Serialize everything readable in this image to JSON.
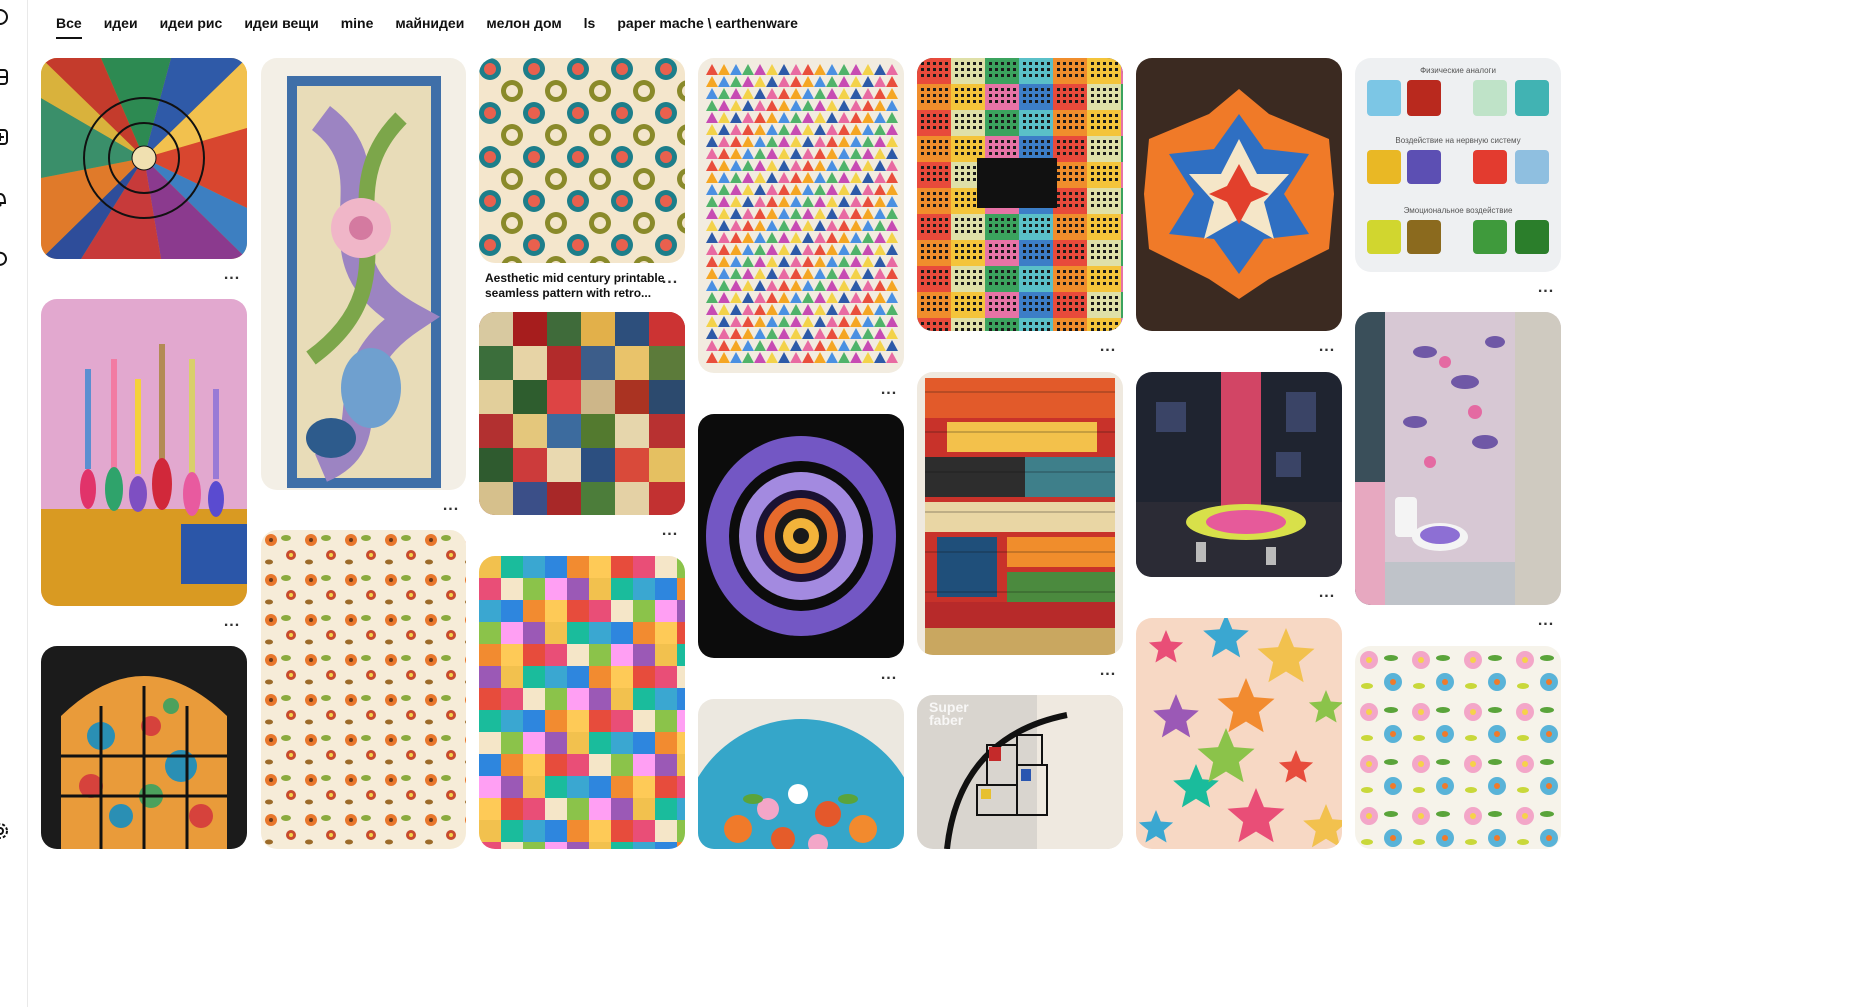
{
  "tabs": [
    {
      "label": "Все",
      "active": true
    },
    {
      "label": "идеи"
    },
    {
      "label": "идеи рис"
    },
    {
      "label": "идеи вещи"
    },
    {
      "label": "mine"
    },
    {
      "label": "майнидеи"
    },
    {
      "label": "мелон дом"
    },
    {
      "label": "ls"
    },
    {
      "label": "paper mache \\ earthenware"
    }
  ],
  "rail": {
    "icons": [
      "pinterest-icon",
      "home-icon",
      "create-icon",
      "bell-icon",
      "messages-icon",
      "settings-icon"
    ]
  },
  "pins": {
    "p1": "Multicolor geometric painting",
    "p2": "Pastel floral textile panel",
    "p3": "Polka dot pattern",
    "p3_caption": "Aesthetic mid century printable\nseamless pattern with retro...",
    "p4": "Patchwork quilt",
    "p5": "Color checkerboard",
    "p6": "Triangle weave pattern",
    "p7": "Purple swirl poster",
    "p8": "Flower circle print",
    "p9": "Pixel city painting",
    "p10": "Woven rug",
    "p11": "Modern staircase",
    "p12": "Geometric star mosaic",
    "p13": "Glitter room",
    "p14": "Star collage",
    "p15": "Color effects chart",
    "p16": "Flower mosaic bathroom",
    "p17": "Floral dot pattern",
    "p18": "Candlesticks on table",
    "p19": "Stained glass window art"
  },
  "chart_overlay_p15": {
    "title": "Физические аналоги",
    "sub1": "Воздействие на нервную систему",
    "sub2": "Эмоциональное воздействие"
  },
  "p11_watermark": "Super\nfaber",
  "colors": {
    "accent": "#111111",
    "rail_border": "#e9e9e9"
  }
}
